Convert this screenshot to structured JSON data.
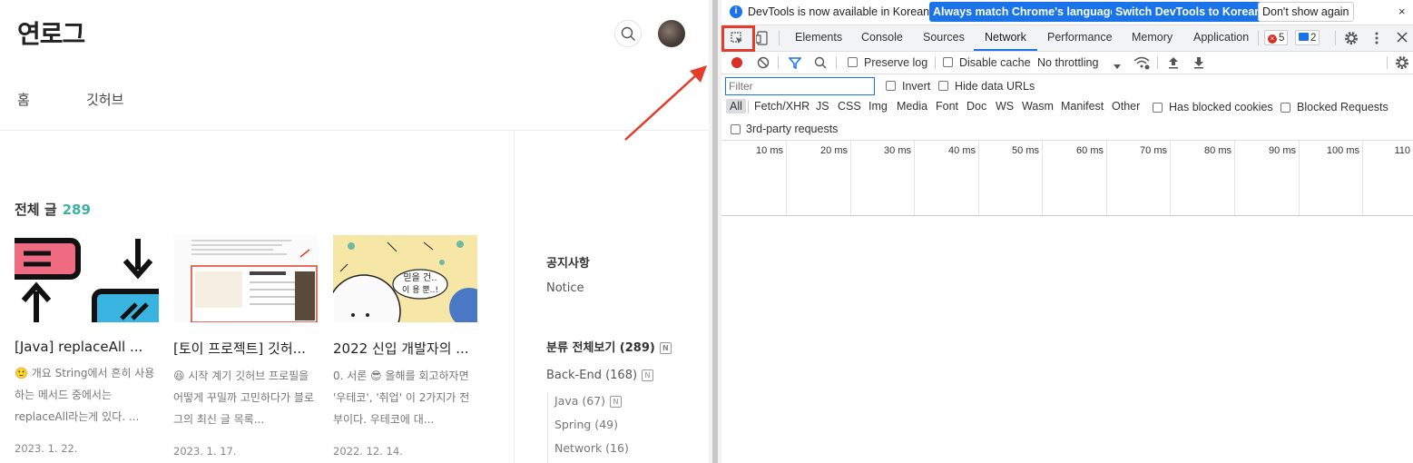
{
  "blog": {
    "logo": "연로그",
    "nav": [
      "홈",
      "깃허브"
    ],
    "section_title": "전체 글",
    "section_count": "289",
    "posts": [
      {
        "title": "[Java] replaceAll ...",
        "excerpt": "🙂 개요 String에서 흔히 사용하는 메서드 중에서는 replaceAll라는게 있다. ...",
        "date": "2023. 1. 22."
      },
      {
        "title": "[토이 프로젝트] 깃허...",
        "excerpt": "😆 시작 계기 깃허브 프로필을 어떻게 꾸밀까 고민하다가 블로그의 최신 글 목록...",
        "date": "2023. 1. 17."
      },
      {
        "title": "2022 신입 개발자의 ...",
        "excerpt": "0. 서론 😎 올해를 회고하자면 '우테코', '취업' 이 2가지가 전부이다. 우테코에 대...",
        "date": "2022. 12. 14."
      }
    ],
    "sidebar": {
      "notice_heading": "공지사항",
      "notice_item": "Notice",
      "category_all": "분류 전체보기 (289)",
      "category_backend": "Back-End (168)",
      "new_badge": "N",
      "sub_categories": [
        "Java (67)",
        "Spring (49)",
        "Network (16)"
      ]
    },
    "thumb3_bubbles": [
      "믿을 건..",
      "이 용 뿐..!"
    ]
  },
  "devtools": {
    "infobar": {
      "icon": "i",
      "message": "DevTools is now available in Korean!",
      "btn_match": "Always match Chrome's language",
      "btn_switch": "Switch DevTools to Korean",
      "btn_dismiss": "Don't show again",
      "close": "×"
    },
    "tabs": [
      "Elements",
      "Console",
      "Sources",
      "Network",
      "Performance",
      "Memory",
      "Application"
    ],
    "active_tab": "Network",
    "error_count": "5",
    "message_count": "2",
    "toolbar": {
      "preserve_log": "Preserve log",
      "disable_cache": "Disable cache",
      "throttling": "No throttling"
    },
    "filter": {
      "placeholder": "Filter",
      "invert": "Invert",
      "hide_data_urls": "Hide data URLs",
      "types": [
        "All",
        "Fetch/XHR",
        "JS",
        "CSS",
        "Img",
        "Media",
        "Font",
        "Doc",
        "WS",
        "Wasm",
        "Manifest",
        "Other"
      ],
      "has_blocked_cookies": "Has blocked cookies",
      "blocked_requests": "Blocked Requests",
      "third_party": "3rd-party requests"
    },
    "timeline_ticks": [
      "10 ms",
      "20 ms",
      "30 ms",
      "40 ms",
      "50 ms",
      "60 ms",
      "70 ms",
      "80 ms",
      "90 ms",
      "100 ms",
      "110"
    ]
  },
  "colors": {
    "accent_teal": "#3db1a4",
    "chrome_blue": "#1a73e8",
    "highlight_red": "#e53b2c"
  }
}
